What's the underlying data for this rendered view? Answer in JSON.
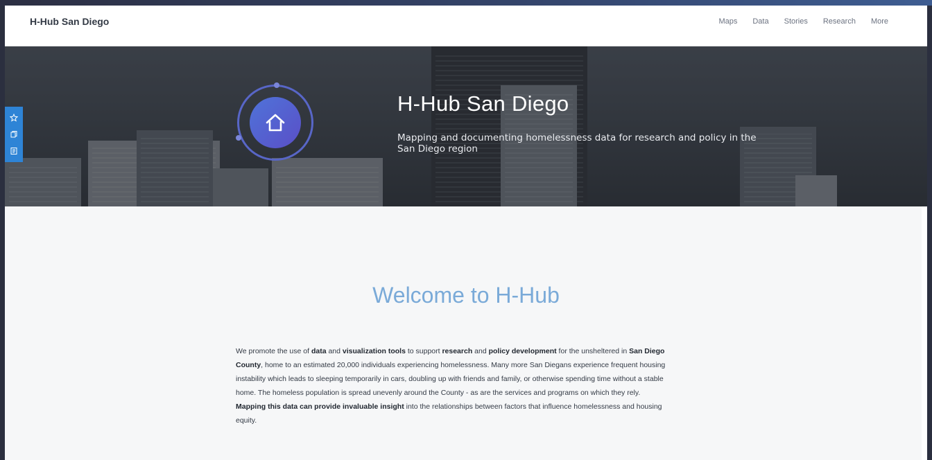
{
  "brand": "H-Hub San Diego",
  "nav": {
    "items": [
      "Maps",
      "Data",
      "Stories",
      "Research",
      "More"
    ]
  },
  "hero": {
    "title": "H-Hub San Diego",
    "subtitle": "Mapping and documenting homelessness data for research and policy in the San Diego region",
    "logo_icon": "home-icon"
  },
  "side_widget": {
    "icons": [
      "star-icon",
      "copy-icon",
      "document-icon"
    ]
  },
  "welcome": {
    "heading": "Welcome to H-Hub",
    "segments": [
      {
        "t": "We promote the use of ",
        "b": false
      },
      {
        "t": "data",
        "b": true
      },
      {
        "t": " and ",
        "b": false
      },
      {
        "t": "visualization tools",
        "b": true
      },
      {
        "t": " to support ",
        "b": false
      },
      {
        "t": "research",
        "b": true
      },
      {
        "t": " and ",
        "b": false
      },
      {
        "t": "policy development",
        "b": true
      },
      {
        "t": " for the unsheltered in ",
        "b": false
      },
      {
        "t": "San Diego County",
        "b": true
      },
      {
        "t": ", home to an estimated 20,000 individuals experiencing homelessness. Many more San Diegans experience frequent housing instability which leads to sleeping temporarily in cars, doubling up with friends and family, or otherwise spending time without a stable home. The homeless population is spread unevenly around the County - as are the services and programs on which they rely. ",
        "b": false
      },
      {
        "t": "Mapping this data can provide invaluable insight",
        "b": true
      },
      {
        "t": " into the relationships between factors that influence homelessness and housing equity.",
        "b": false
      }
    ]
  },
  "colors": {
    "accent": "#7aaad8",
    "widget": "#2e84d6",
    "logo": "#5a4fc7"
  }
}
